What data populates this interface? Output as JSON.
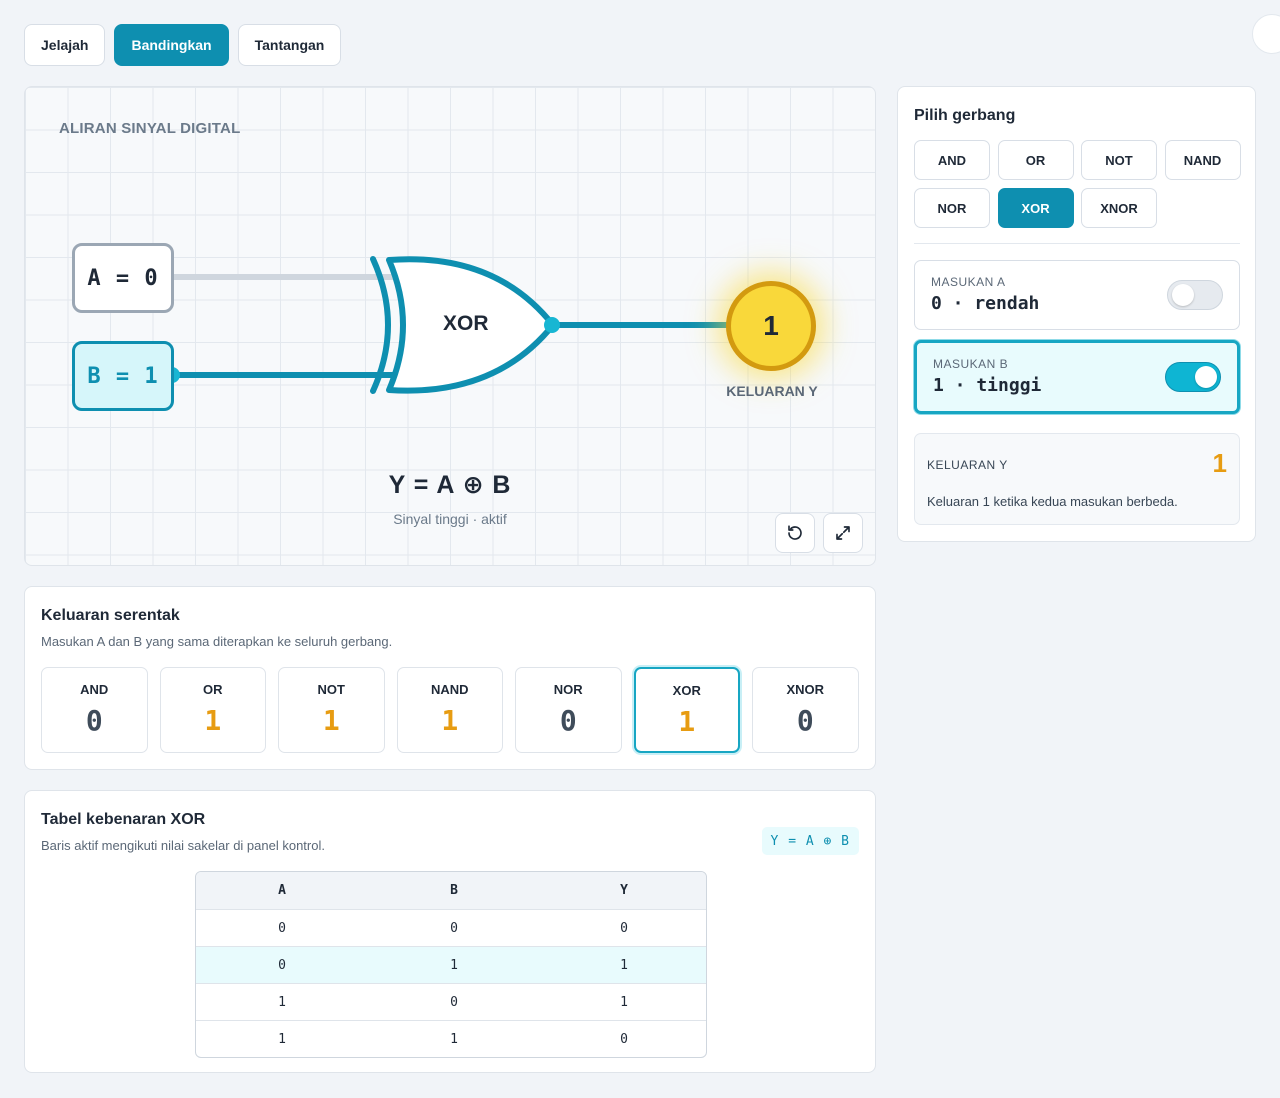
{
  "tabs": [
    {
      "label": "Jelajah",
      "active": false
    },
    {
      "label": "Bandingkan",
      "active": true
    },
    {
      "label": "Tantangan",
      "active": false
    }
  ],
  "canvas": {
    "label": "ALIRAN SINYAL DIGITAL",
    "input_a": "A = 0",
    "input_b": "B = 1",
    "gate": "XOR",
    "output_value": "1",
    "output_label": "KELUARAN Y",
    "formula": "Y = A ⊕ B",
    "subtitle": "Sinyal tinggi · aktif",
    "icons": [
      "reset-icon",
      "expand-icon"
    ]
  },
  "control": {
    "title": "Pilih gerbang",
    "gates": [
      {
        "label": "AND",
        "active": false
      },
      {
        "label": "OR",
        "active": false
      },
      {
        "label": "NOT",
        "active": false
      },
      {
        "label": "NAND",
        "active": false
      },
      {
        "label": "NOR",
        "active": false
      },
      {
        "label": "XOR",
        "active": true
      },
      {
        "label": "XNOR",
        "active": false
      }
    ],
    "input_a": {
      "label": "MASUKAN A",
      "value": "0 · rendah",
      "on": false
    },
    "input_b": {
      "label": "MASUKAN B",
      "value": "1 · tinggi",
      "on": true
    },
    "output": {
      "label": "KELUARAN Y",
      "value": "1",
      "description": "Keluaran 1 ketika kedua masukan berbeda."
    }
  },
  "simultaneous": {
    "title": "Keluaran serentak",
    "subtitle": "Masukan A dan B yang sama diterapkan ke seluruh gerbang.",
    "items": [
      {
        "name": "AND",
        "value": "0",
        "active": false
      },
      {
        "name": "OR",
        "value": "1",
        "active": false
      },
      {
        "name": "NOT",
        "value": "1",
        "active": false
      },
      {
        "name": "NAND",
        "value": "1",
        "active": false
      },
      {
        "name": "NOR",
        "value": "0",
        "active": false
      },
      {
        "name": "XOR",
        "value": "1",
        "active": true
      },
      {
        "name": "XNOR",
        "value": "0",
        "active": false
      }
    ]
  },
  "truth_table": {
    "title": "Tabel kebenaran XOR",
    "subtitle": "Baris aktif mengikuti nilai sakelar di panel kontrol.",
    "formula_chip": "Y = A ⊕ B",
    "headers": [
      "A",
      "B",
      "Y"
    ],
    "rows": [
      {
        "cells": [
          "0",
          "0",
          "0"
        ],
        "active": false
      },
      {
        "cells": [
          "0",
          "1",
          "1"
        ],
        "active": true
      },
      {
        "cells": [
          "1",
          "0",
          "1"
        ],
        "active": false
      },
      {
        "cells": [
          "1",
          "1",
          "0"
        ],
        "active": false
      }
    ]
  },
  "colors": {
    "accent": "#0e8fb0",
    "high": "#e79c12",
    "bulb": "#f9d83a",
    "wire_low": "#cfd6de"
  }
}
